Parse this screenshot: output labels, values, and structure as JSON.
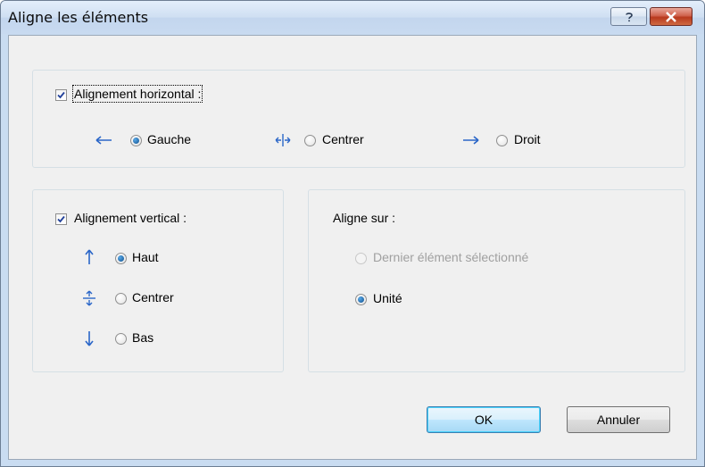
{
  "window": {
    "title": "Aligne les éléments"
  },
  "titlebar": {
    "help_label": "?",
    "close_label": "✕"
  },
  "horizontal": {
    "checkbox_label": "Alignement horizontal :",
    "checked": true,
    "options": [
      {
        "label": "Gauche",
        "selected": true,
        "icon": "arrow-left-icon"
      },
      {
        "label": "Centrer",
        "selected": false,
        "icon": "arrows-horizontal-center-icon"
      },
      {
        "label": "Droit",
        "selected": false,
        "icon": "arrow-right-icon"
      }
    ]
  },
  "vertical": {
    "checkbox_label": "Alignement vertical :",
    "checked": true,
    "options": [
      {
        "label": "Haut",
        "selected": true,
        "icon": "arrow-up-icon"
      },
      {
        "label": "Centrer",
        "selected": false,
        "icon": "arrows-vertical-center-icon"
      },
      {
        "label": "Bas",
        "selected": false,
        "icon": "arrow-down-icon"
      }
    ]
  },
  "align_to": {
    "label": "Aligne sur :",
    "options": [
      {
        "label": "Dernier élément sélectionné",
        "selected": false,
        "disabled": true
      },
      {
        "label": "Unité",
        "selected": true,
        "disabled": false
      }
    ]
  },
  "buttons": {
    "ok": "OK",
    "cancel": "Annuler"
  },
  "colors": {
    "accent": "#1e6fd0",
    "title_bg": "#c9dcf1"
  }
}
